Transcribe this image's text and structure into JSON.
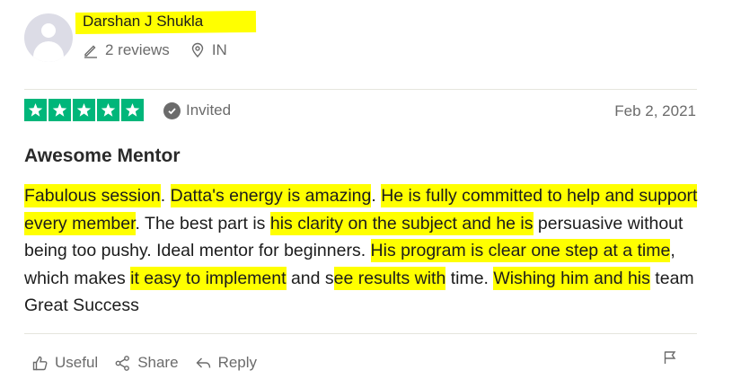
{
  "reviewer": {
    "name": "Darshan J Shukla",
    "reviews_count": "2 reviews",
    "country": "IN"
  },
  "rating": {
    "stars": 5,
    "max": 5,
    "color": "#00b67a"
  },
  "badge": {
    "label": "Invited"
  },
  "date": "Feb 2, 2021",
  "review": {
    "title": "Awesome Mentor",
    "segments": [
      {
        "text": "Fabulous session",
        "highlight": true
      },
      {
        "text": ". ",
        "highlight": false
      },
      {
        "text": "Datta's energy is amazing",
        "highlight": true
      },
      {
        "text": ". ",
        "highlight": false
      },
      {
        "text": "He is fully committed to help and support every member",
        "highlight": true
      },
      {
        "text": ". The best part is ",
        "highlight": false
      },
      {
        "text": "his clarity on the subject and he is",
        "highlight": true
      },
      {
        "text": " persuasive without being too pushy. Ideal mentor for beginners. ",
        "highlight": false
      },
      {
        "text": "His program is clear one step at a time",
        "highlight": true
      },
      {
        "text": ", which makes ",
        "highlight": false
      },
      {
        "text": "it easy to implement",
        "highlight": true
      },
      {
        "text": " and s",
        "highlight": false
      },
      {
        "text": "ee results with",
        "highlight": true
      },
      {
        "text": " time. ",
        "highlight": false
      },
      {
        "text": "Wishing him and his",
        "highlight": true
      },
      {
        "text": " team Great Success",
        "highlight": false
      }
    ]
  },
  "actions": {
    "useful": "Useful",
    "share": "Share",
    "reply": "Reply"
  },
  "colors": {
    "highlight": "#ffff00",
    "muted": "#6b6b6b"
  }
}
